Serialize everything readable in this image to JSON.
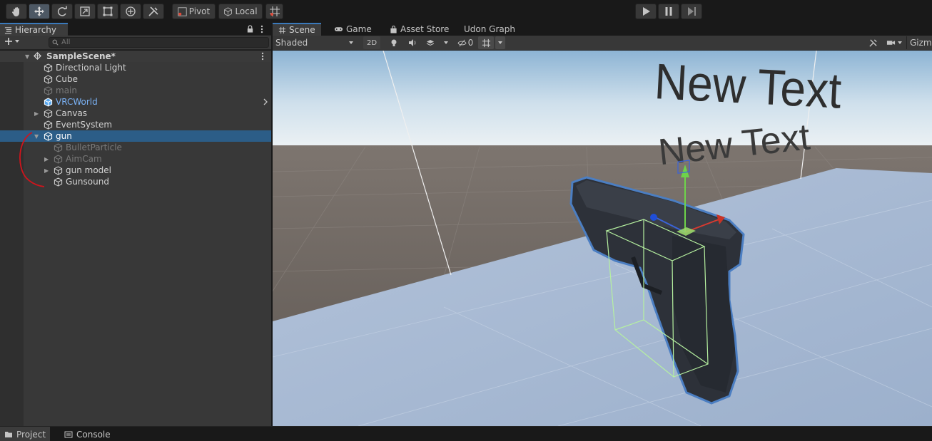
{
  "toolbar": {
    "tools": [
      {
        "icon": "hand-icon"
      },
      {
        "icon": "move-icon",
        "active": true
      },
      {
        "icon": "rotate-icon"
      },
      {
        "icon": "scale-icon"
      },
      {
        "icon": "rect-tool-icon"
      },
      {
        "icon": "transform-icon"
      },
      {
        "icon": "custom-tool-icon"
      }
    ],
    "pivot_label": "Pivot",
    "local_label": "Local",
    "snap_icon": "grid-snap-icon",
    "play_icon": "play-icon",
    "pause_icon": "pause-icon",
    "step_icon": "step-icon"
  },
  "hierarchy": {
    "tab_label": "Hierarchy",
    "search_placeholder": "All",
    "scene_name": "SampleScene*",
    "items": [
      {
        "label": "Directional Light",
        "depth": 1,
        "state": "normal"
      },
      {
        "label": "Cube",
        "depth": 1,
        "state": "normal"
      },
      {
        "label": "main",
        "depth": 1,
        "state": "disabled"
      },
      {
        "label": "VRCWorld",
        "depth": 1,
        "state": "prefab",
        "has_arrow_right": true
      },
      {
        "label": "Canvas",
        "depth": 1,
        "state": "normal",
        "foldout": "collapsed"
      },
      {
        "label": "EventSystem",
        "depth": 1,
        "state": "normal"
      },
      {
        "label": "gun",
        "depth": 1,
        "state": "selected",
        "foldout": "expanded"
      },
      {
        "label": "BulletParticle",
        "depth": 2,
        "state": "disabled"
      },
      {
        "label": "AimCam",
        "depth": 2,
        "state": "disabled",
        "foldout": "collapsed"
      },
      {
        "label": "gun model",
        "depth": 2,
        "state": "normal",
        "foldout": "collapsed"
      },
      {
        "label": "Gunsound",
        "depth": 2,
        "state": "normal"
      }
    ]
  },
  "scene_tabs": [
    {
      "label": "Scene",
      "icon": "hash-icon",
      "active": true
    },
    {
      "label": "Game",
      "icon": "gamepad-icon"
    },
    {
      "label": "Asset Store",
      "icon": "bag-icon"
    },
    {
      "label": "Udon Graph"
    }
  ],
  "scene_toolbar": {
    "shading_mode": "Shaded",
    "mode_2d": "2D",
    "hidden_count": "0",
    "gizmos_label": "Gizmos"
  },
  "viewport": {
    "text_objects": [
      "New Text",
      "New Text"
    ]
  },
  "bottom_tabs": [
    {
      "label": "Project",
      "icon": "folder-icon",
      "active": true
    },
    {
      "label": "Console",
      "icon": "console-icon"
    }
  ],
  "colors": {
    "selection": "#2c5d87",
    "prefab_blue": "#7bb3f7",
    "disabled_text": "#7a7a7a",
    "annotation_red": "#d0141c",
    "sky_top": "#9fc4de",
    "floor": "#a7b9d3",
    "ground": "#6a615c"
  }
}
